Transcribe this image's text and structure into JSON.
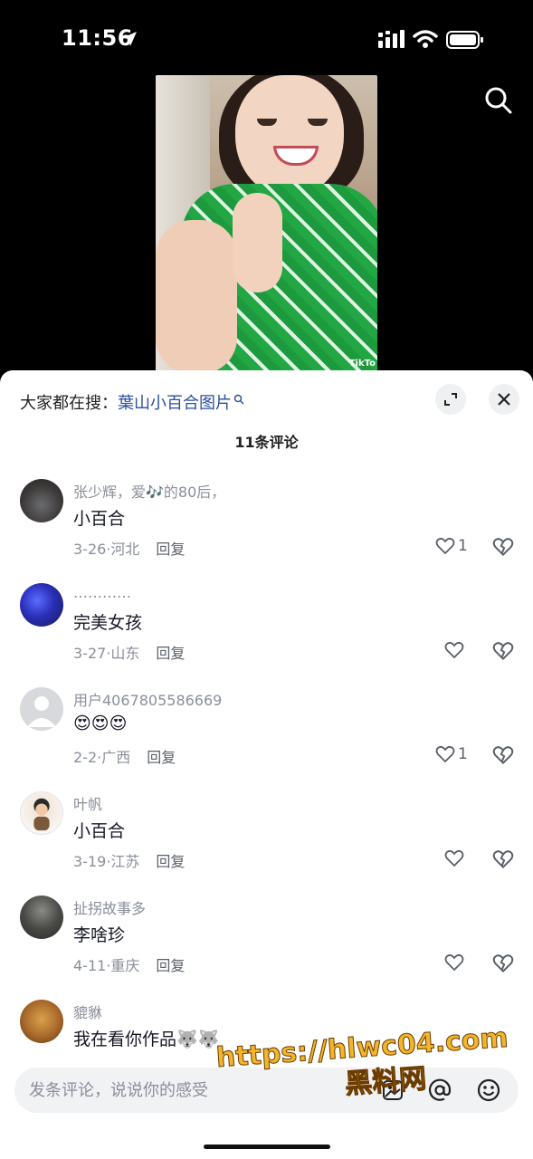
{
  "status": {
    "time": "11:56"
  },
  "hot_search": {
    "prefix": "大家都在搜：",
    "query": "葉山小百合图片"
  },
  "comments_count": "11条评论",
  "comments": [
    {
      "user": "张少辉，爱🎶的80后，",
      "text": "小百合",
      "date": "3-26",
      "location": "河北",
      "reply": "回复",
      "likes": "1"
    },
    {
      "user": "…………",
      "text": "完美女孩",
      "date": "3-27",
      "location": "山东",
      "reply": "回复",
      "likes": ""
    },
    {
      "user": "用户4067805586669",
      "text": "😍😍😍",
      "date": "2-2",
      "location": "广西",
      "reply": "回复",
      "likes": "1"
    },
    {
      "user": "叶帆",
      "text": "小百合",
      "date": "3-19",
      "location": "江苏",
      "reply": "回复",
      "likes": ""
    },
    {
      "user": "扯拐故事多",
      "text": "李啥珍",
      "date": "4-11",
      "location": "重庆",
      "reply": "回复",
      "likes": ""
    },
    {
      "user": "貔貅",
      "text": "我在看你作品🐺🐺",
      "date": "",
      "location": "",
      "reply": "",
      "likes": ""
    }
  ],
  "input": {
    "placeholder": "发条评论，说说你的感受"
  },
  "watermark": {
    "line1": "https://hlwc04.com",
    "line2": "黑料网"
  },
  "icons": [
    "location-arrow-icon",
    "signal-icon",
    "wifi-icon",
    "battery-icon",
    "search-icon",
    "expand-icon",
    "close-icon",
    "heart-icon",
    "broken-heart-icon",
    "image-icon",
    "at-icon",
    "emoji-icon"
  ]
}
